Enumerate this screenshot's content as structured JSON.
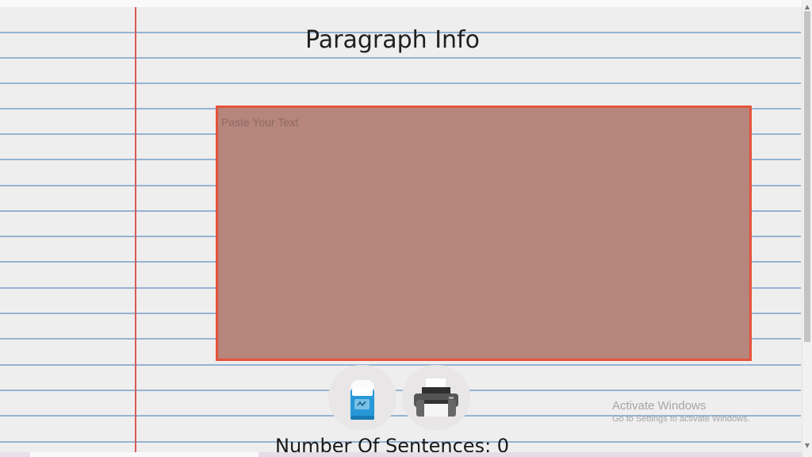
{
  "page": {
    "title": "Paragraph Info"
  },
  "editor": {
    "placeholder": "Paste Your Text",
    "value": ""
  },
  "actions": {
    "clear_icon": "eraser-icon",
    "print_icon": "printer-icon"
  },
  "stats": {
    "sentence_count_label": "Number Of Sentences: 0"
  },
  "watermark": {
    "title": "Activate Windows",
    "subtitle": "Go to Settings to activate Windows."
  },
  "scrollbar": {
    "up_icon": "chevron-up-icon",
    "down_icon": "chevron-down-icon"
  },
  "colors": {
    "background": "#efeeee",
    "rule_line": "#8fb0cf",
    "margin_line": "#d65a58",
    "textarea_fill": "#b6857b",
    "textarea_border": "#e5533b"
  }
}
